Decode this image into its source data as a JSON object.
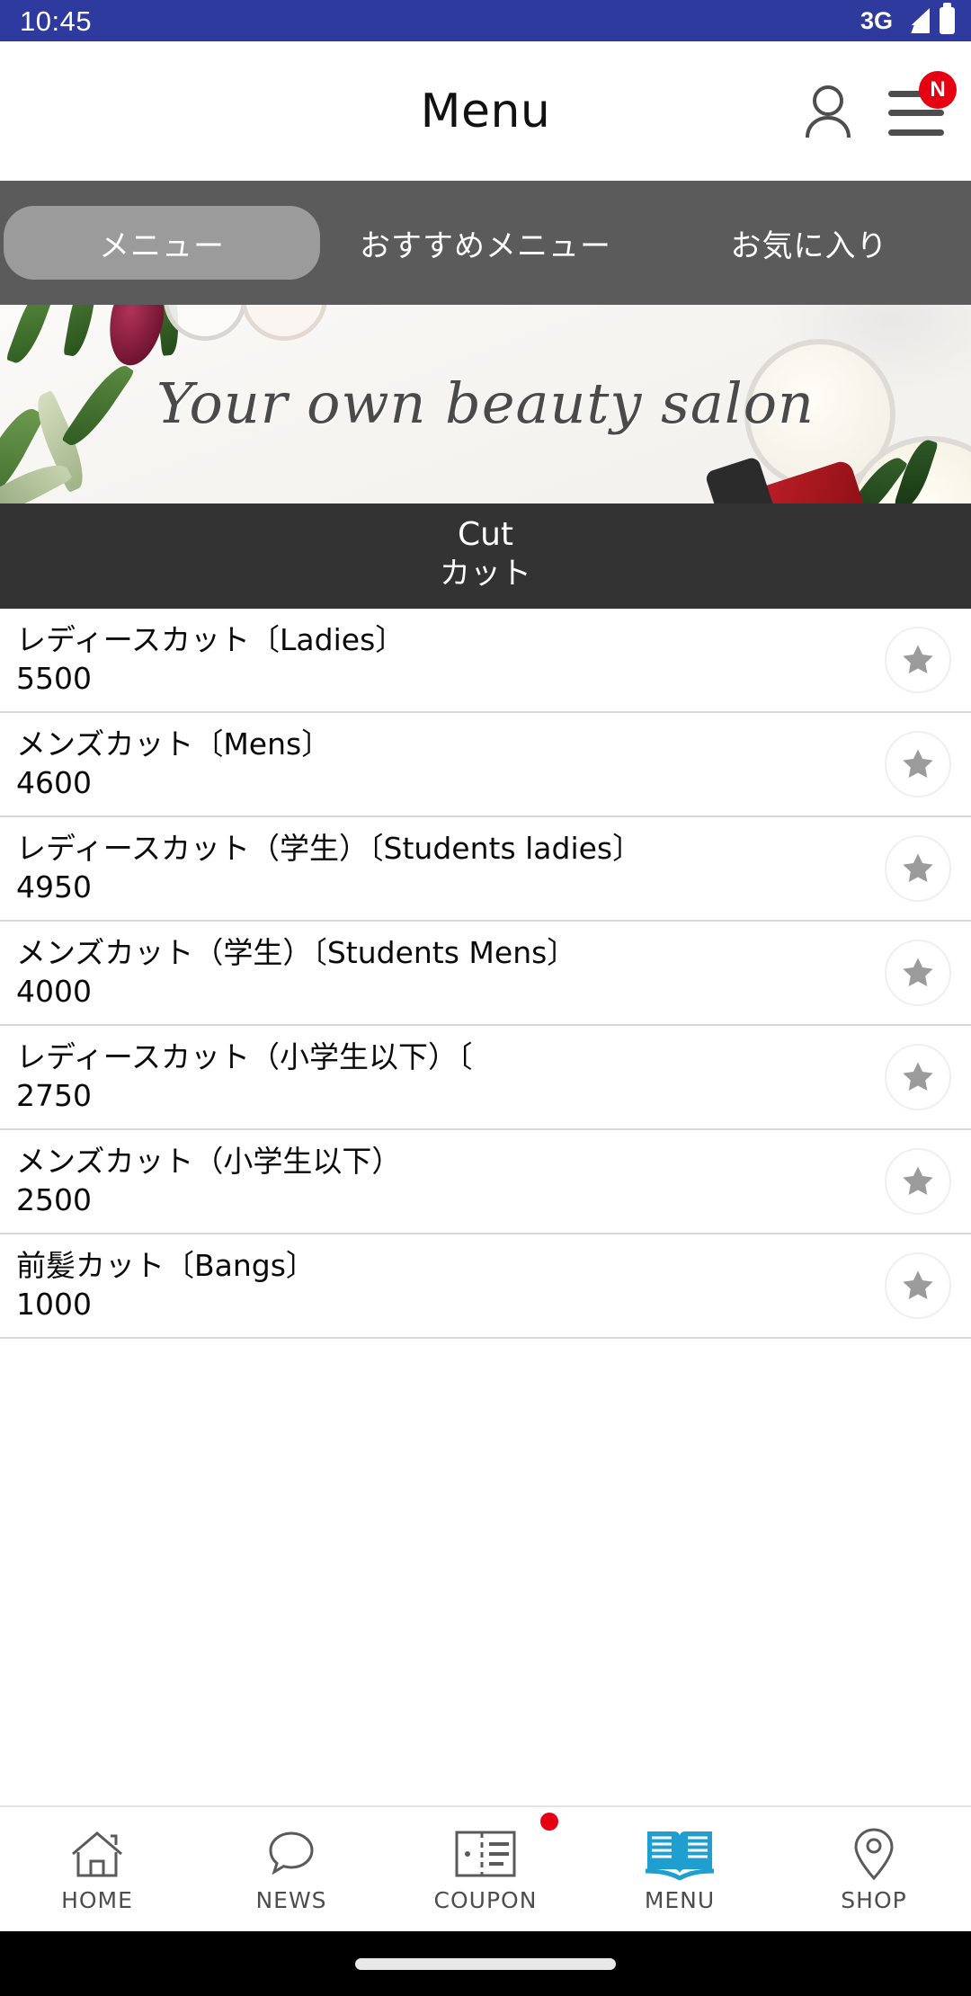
{
  "status_bar": {
    "time": "10:45",
    "network": "3G",
    "signal_icon": "signal-triangle-icon",
    "battery_icon": "battery-full-icon",
    "background_color": "#2f3a9e"
  },
  "app_bar": {
    "title": "Menu",
    "account_icon": "person-icon",
    "menu_icon": "hamburger-icon",
    "menu_badge": "N",
    "badge_color": "#e50012"
  },
  "tabs": {
    "active_index": 0,
    "items": [
      {
        "label": "メニュー",
        "name": "tab-menu"
      },
      {
        "label": "おすすめメニュー",
        "name": "tab-recommended-menu"
      },
      {
        "label": "お気に入り",
        "name": "tab-favorites"
      }
    ]
  },
  "banner": {
    "script_text": "Your own beauty salon",
    "alt": "beauty salon banner with olive branches and cosmetic jars"
  },
  "category": {
    "title_en": "Cut",
    "title_jp": "カット",
    "background_color": "#333333"
  },
  "menu_items": [
    {
      "name": "レディースカット〔Ladies〕",
      "price": "5500",
      "favorite_icon": "star-icon"
    },
    {
      "name": "メンズカット〔Mens〕",
      "price": "4600",
      "favorite_icon": "star-icon"
    },
    {
      "name": "レディースカット（学生）〔Students ladies〕",
      "price": "4950",
      "favorite_icon": "star-icon"
    },
    {
      "name": "メンズカット（学生）〔Students Mens〕",
      "price": "4000",
      "favorite_icon": "star-icon"
    },
    {
      "name": "レディースカット（小学生以下）〔",
      "price": "2750",
      "favorite_icon": "star-icon"
    },
    {
      "name": "メンズカット（小学生以下）",
      "price": "2500",
      "favorite_icon": "star-icon"
    },
    {
      "name": "前髪カット〔Bangs〕",
      "price": "1000",
      "favorite_icon": "star-icon"
    }
  ],
  "bottom_nav": {
    "active_index": 3,
    "active_color": "#1f9ed0",
    "items": [
      {
        "label": "HOME",
        "icon": "home-icon",
        "badge": false
      },
      {
        "label": "NEWS",
        "icon": "speech-bubble-icon",
        "badge": false
      },
      {
        "label": "COUPON",
        "icon": "ticket-icon",
        "badge": true
      },
      {
        "label": "MENU",
        "icon": "open-book-icon",
        "badge": false
      },
      {
        "label": "SHOP",
        "icon": "location-pin-icon",
        "badge": false
      }
    ]
  }
}
